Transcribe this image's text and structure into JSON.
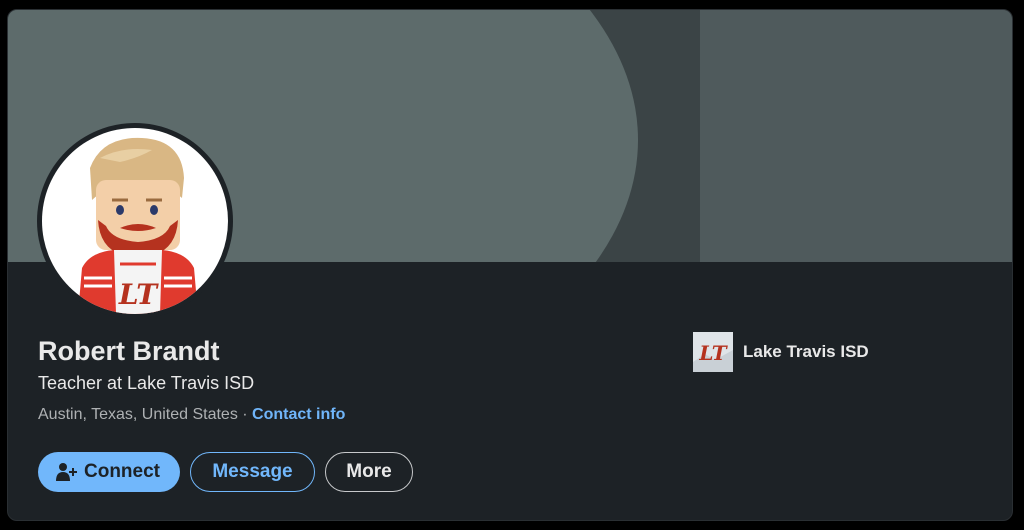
{
  "profile": {
    "name": "Robert Brandt",
    "headline": "Teacher at Lake Travis ISD",
    "location": "Austin, Texas, United States",
    "separator": "·",
    "contact_label": "Contact info",
    "avatar_label": "LT"
  },
  "actions": {
    "connect_label": "Connect",
    "message_label": "Message",
    "more_label": "More"
  },
  "organization": {
    "name": "Lake Travis ISD",
    "logo_text": "LT",
    "logo_icon": "school-logo-icon"
  },
  "colors": {
    "accent": "#71b7fb",
    "card_bg": "#1d2226",
    "banner_left": "#5d6b6b",
    "banner_mid": "#3b4446",
    "banner_right": "#4f5a5c"
  }
}
